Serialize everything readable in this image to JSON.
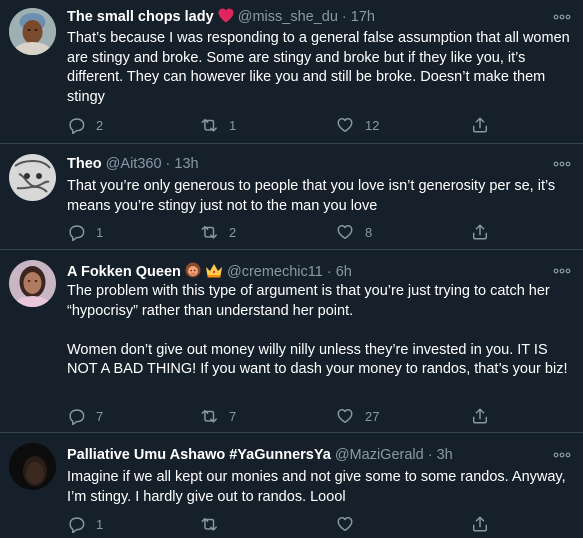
{
  "colors": {
    "background": "#15202b",
    "divider": "#38444d",
    "secondary_text": "#8899a6",
    "primary_text": "#ffffff",
    "heart_emoji": "#e0245e"
  },
  "tweets": [
    {
      "name": "The small chops lady",
      "name_emoji": "heart-emoji",
      "handle": "@miss_she_du",
      "separator": "·",
      "time": "17h",
      "text": [
        "That’s because I was responding to a general false assumption that all women are stingy and broke. Some are stingy and broke but if they like you, it’s different. They can however like you and still be broke. Doesn’t make them stingy"
      ],
      "replies": "2",
      "retweets": "1",
      "likes": "12"
    },
    {
      "name": "Theo",
      "handle": "@Ait360",
      "separator": "·",
      "time": "13h",
      "text": [
        "That you’re only generous to people that you love isn’t generosity per se, it’s means you’re stingy just not to the man you love"
      ],
      "replies": "1",
      "retweets": "2",
      "likes": "8"
    },
    {
      "name": "A Fokken Queen",
      "name_emoji": "woman-emoji crown-emoji",
      "handle": "@cremechic11",
      "separator": "·",
      "time": "6h",
      "text": [
        "The problem with this type of argument is that you’re just trying to catch her “hypocrisy” rather than understand her point.",
        "Women don’t give out money willy nilly unless they’re invested in you. IT IS NOT A BAD THING! If you want to dash your money to randos, that’s your biz!"
      ],
      "replies": "7",
      "retweets": "7",
      "likes": "27"
    },
    {
      "name": "Palliative Umu Ashawo #YaGunnersYa",
      "handle": "@MaziGerald",
      "separator": "·",
      "time": "3h",
      "text": [
        "Imagine if we all kept our monies and not give some to some randos. Anyway, I’m stingy. I hardly give out to randos. Loool"
      ],
      "replies": "1",
      "retweets": "",
      "likes": ""
    }
  ]
}
